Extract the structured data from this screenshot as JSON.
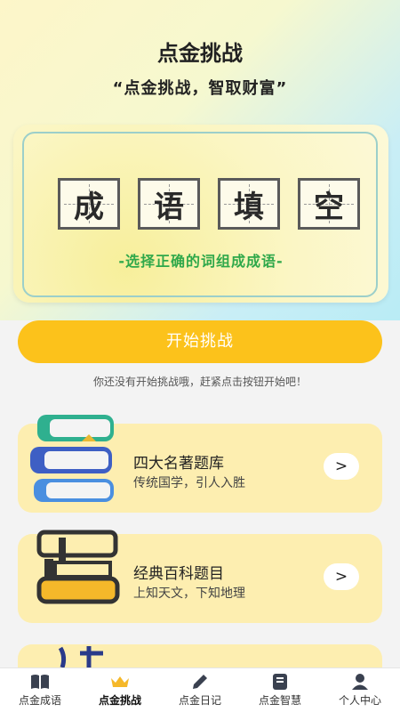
{
  "header": {
    "title": "点金挑战",
    "subtitle": "“点金挑战，智取财富”"
  },
  "hero": {
    "tiles": [
      "成",
      "语",
      "填",
      "空"
    ],
    "caption": "-选择正确的词组成成语-"
  },
  "start_button": "开始挑战",
  "hint": "你还没有开始挑战哦，赶紧点击按钮开始吧！",
  "cards": [
    {
      "title": "四大名著题库",
      "desc": "传统国学，引人入胜",
      "arrow": ">"
    },
    {
      "title": "经典百科题目",
      "desc": "上知天文，下知地理",
      "arrow": ">"
    }
  ],
  "tabs": [
    {
      "label": "点金成语",
      "icon": "book-icon"
    },
    {
      "label": "点金挑战",
      "icon": "crown-icon"
    },
    {
      "label": "点金日记",
      "icon": "pen-icon"
    },
    {
      "label": "点金智慧",
      "icon": "notebook-icon"
    },
    {
      "label": "个人中心",
      "icon": "user-icon"
    }
  ],
  "active_tab": 1,
  "colors": {
    "accent": "#fcc21b",
    "card_bg": "#fdeeb0",
    "caption_green": "#2fa84a"
  }
}
